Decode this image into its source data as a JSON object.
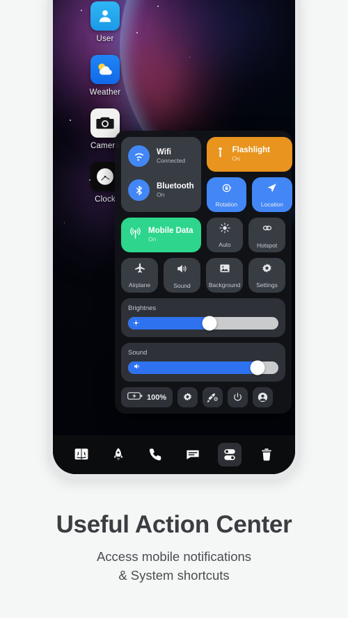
{
  "wallpaper": {
    "description": "space-nebula-with-blue-planet"
  },
  "desktop_icons": [
    {
      "label": "User",
      "icon": "user-contact-icon"
    },
    {
      "label": "Weather",
      "icon": "sun-cloud-icon"
    },
    {
      "label": "Camera",
      "icon": "camera-icon"
    },
    {
      "label": "Clock",
      "icon": "analog-clock-icon"
    }
  ],
  "control_center": {
    "connectivity": [
      {
        "name": "Wifi",
        "status": "Connected",
        "icon": "wifi-icon",
        "badge_color": "#4287f5"
      },
      {
        "name": "Bluetooth",
        "status": "On",
        "icon": "bluetooth-icon",
        "badge_color": "#4287f5"
      }
    ],
    "wide_tiles": [
      {
        "name": "Flashlight",
        "status": "On",
        "icon": "flashlight-icon",
        "color": "#e8941e"
      },
      {
        "name": "Mobile Data",
        "status": "On",
        "icon": "cell-signal-icon",
        "color": "#2ed58c"
      }
    ],
    "square_tiles": [
      {
        "name": "Rotation",
        "icon": "rotation-lock-icon",
        "color": "#4287f5",
        "active": true
      },
      {
        "name": "Location",
        "icon": "location-arrow-icon",
        "color": "#4287f5",
        "active": true
      },
      {
        "name": "Auto",
        "icon": "brightness-auto-icon",
        "color": "#383c43",
        "active": false
      },
      {
        "name": "Hotspot",
        "icon": "hotspot-link-icon",
        "color": "#383c43",
        "active": false
      },
      {
        "name": "Airplane",
        "icon": "airplane-icon",
        "color": "#383c43",
        "active": false
      },
      {
        "name": "Sound",
        "icon": "speaker-icon",
        "color": "#383c43",
        "active": false
      },
      {
        "name": "Background",
        "icon": "wallpaper-image-icon",
        "color": "#383c43",
        "active": false
      },
      {
        "name": "Settings",
        "icon": "gear-icon",
        "color": "#383c43",
        "active": false
      }
    ],
    "sliders": [
      {
        "label": "Brightnes",
        "value": 54,
        "icon": "brightness-icon"
      },
      {
        "label": "Sound",
        "value": 86,
        "icon": "volume-icon"
      }
    ],
    "actions": {
      "battery": {
        "percent": "100%",
        "icon": "battery-charging-icon"
      },
      "buttons": [
        {
          "icon": "gear-icon",
          "name": "settings"
        },
        {
          "icon": "cleanup-icon",
          "name": "cleaner"
        },
        {
          "icon": "power-icon",
          "name": "power"
        },
        {
          "icon": "account-icon",
          "name": "account"
        }
      ]
    }
  },
  "dock": [
    {
      "icon": "finder-icon",
      "name": "finder",
      "active": false
    },
    {
      "icon": "rocket-icon",
      "name": "launchpad",
      "active": false
    },
    {
      "icon": "phone-icon",
      "name": "phone",
      "active": false
    },
    {
      "icon": "message-icon",
      "name": "messages",
      "active": false
    },
    {
      "icon": "toggles-icon",
      "name": "control-center",
      "active": true
    },
    {
      "icon": "trash-icon",
      "name": "trash",
      "active": false
    }
  ],
  "caption": {
    "title": "Useful Action Center",
    "subtitle_line1": "Access mobile notifications",
    "subtitle_line2": "& System shortcuts"
  }
}
